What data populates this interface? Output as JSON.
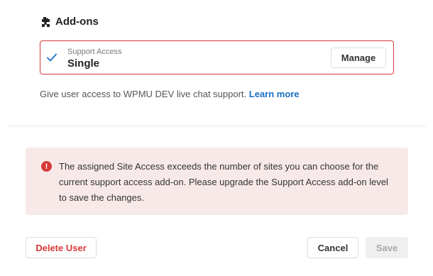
{
  "addons": {
    "title": "Add-ons",
    "title_icon": "puzzle-icon",
    "card": {
      "status_icon": "checkmark-icon",
      "label": "Support Access",
      "value": "Single",
      "manage_label": "Manage"
    },
    "description": "Give user access to WPMU DEV live chat support.",
    "learn_more": "Learn more"
  },
  "notice": {
    "icon": "warning-icon",
    "icon_glyph": "!",
    "message": "The assigned Site Access exceeds the number of sites you can choose for the current support access add-on. Please upgrade the Support Access add-on level to save the changes."
  },
  "footer": {
    "delete_label": "Delete User",
    "cancel_label": "Cancel",
    "save_label": "Save"
  },
  "colors": {
    "error_red": "#d73a3a",
    "notice_bg": "#f8e9e9",
    "link_blue": "#1a6fc4",
    "check_blue": "#1a6fc4"
  }
}
